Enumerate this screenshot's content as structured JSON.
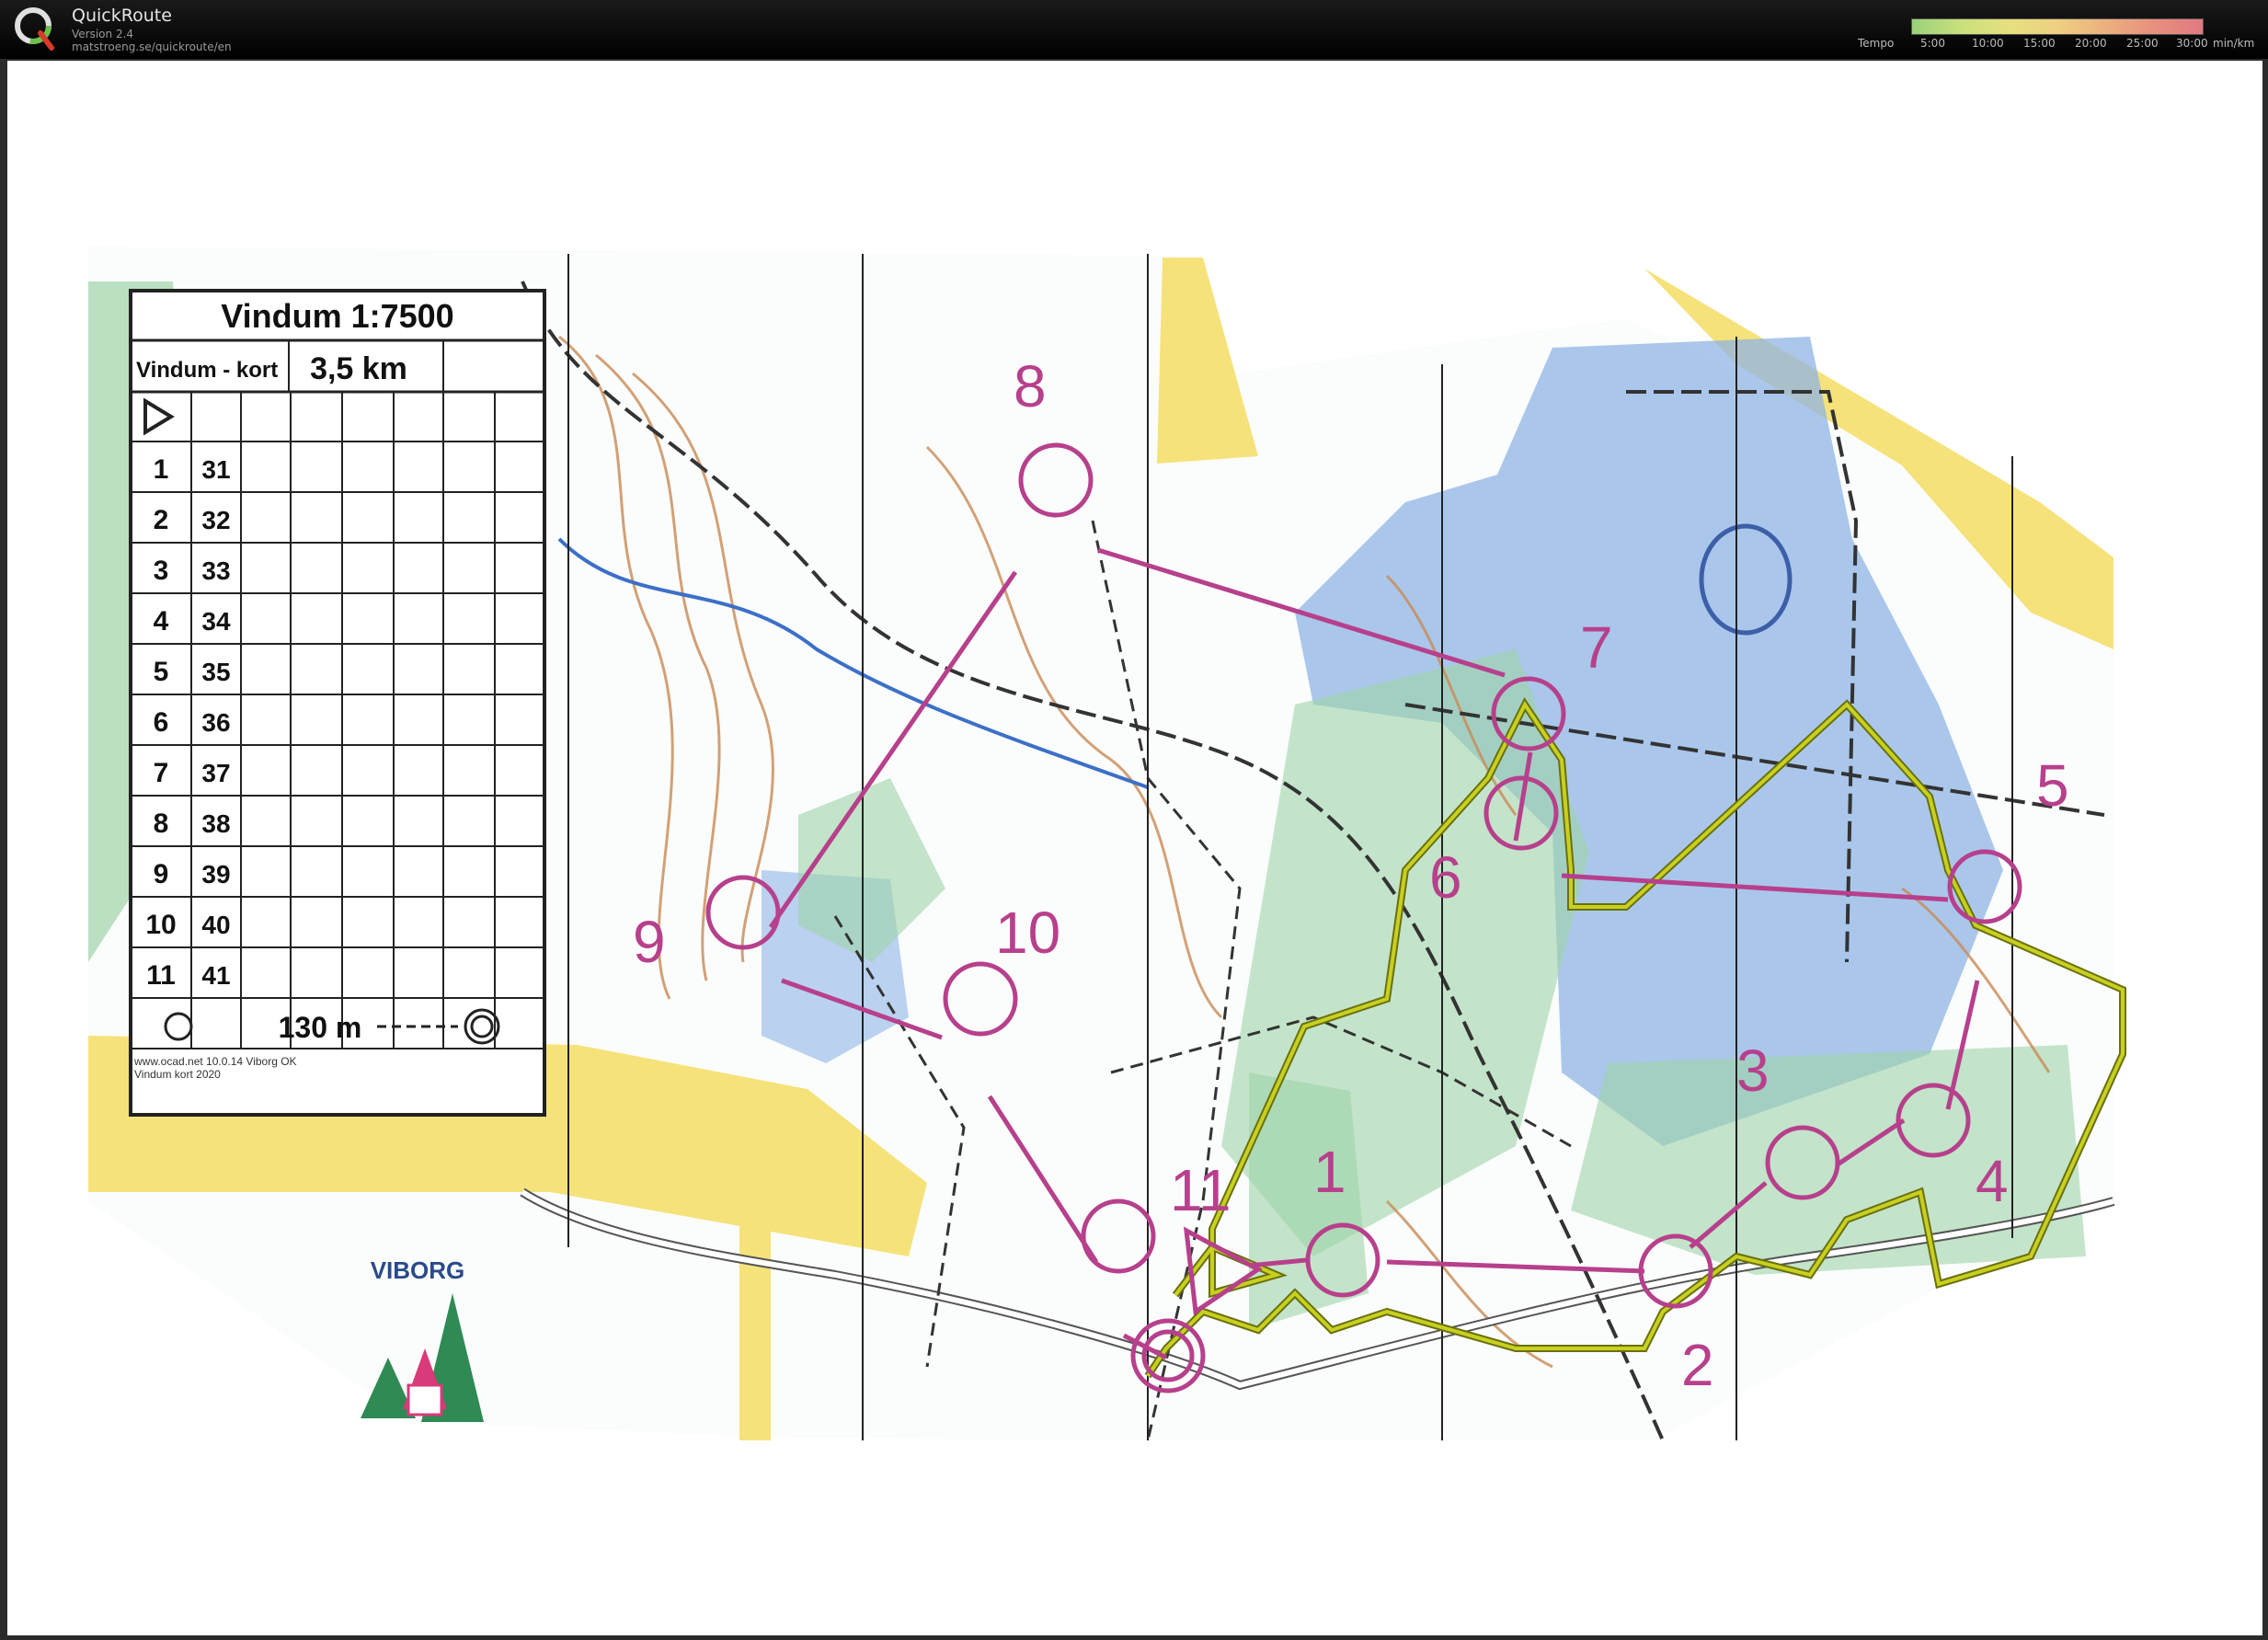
{
  "app": {
    "title": "QuickRoute",
    "version": "Version 2.4",
    "url": "matstroeng.se/quickroute/en"
  },
  "tempo": {
    "label": "Tempo",
    "ticks": [
      "5:00",
      "10:00",
      "15:00",
      "20:00",
      "25:00",
      "30:00"
    ],
    "unit": "min/km"
  },
  "legend": {
    "title": "Vindum 1:7500",
    "course": "Vindum - kort",
    "length": "3,5 km",
    "rows": [
      {
        "n": "1",
        "code": "31"
      },
      {
        "n": "2",
        "code": "32"
      },
      {
        "n": "3",
        "code": "33"
      },
      {
        "n": "4",
        "code": "34"
      },
      {
        "n": "5",
        "code": "35"
      },
      {
        "n": "6",
        "code": "36"
      },
      {
        "n": "7",
        "code": "37"
      },
      {
        "n": "8",
        "code": "38"
      },
      {
        "n": "9",
        "code": "39"
      },
      {
        "n": "10",
        "code": "40"
      },
      {
        "n": "11",
        "code": "41"
      }
    ],
    "finish": "130 m",
    "credit1": "www.ocad.net 10.0.14 Viborg OK",
    "credit2": "Vindum kort 2020"
  },
  "controls": [
    "1",
    "2",
    "3",
    "4",
    "5",
    "6",
    "7",
    "8",
    "9",
    "10",
    "11"
  ],
  "club": "VIBORG",
  "colors": {
    "course": "#b7408c",
    "route": "#c8d020",
    "water": "#8fb4e6",
    "field": "#f6e27a",
    "green": "#9fd3a8",
    "contour": "#c98a55"
  }
}
